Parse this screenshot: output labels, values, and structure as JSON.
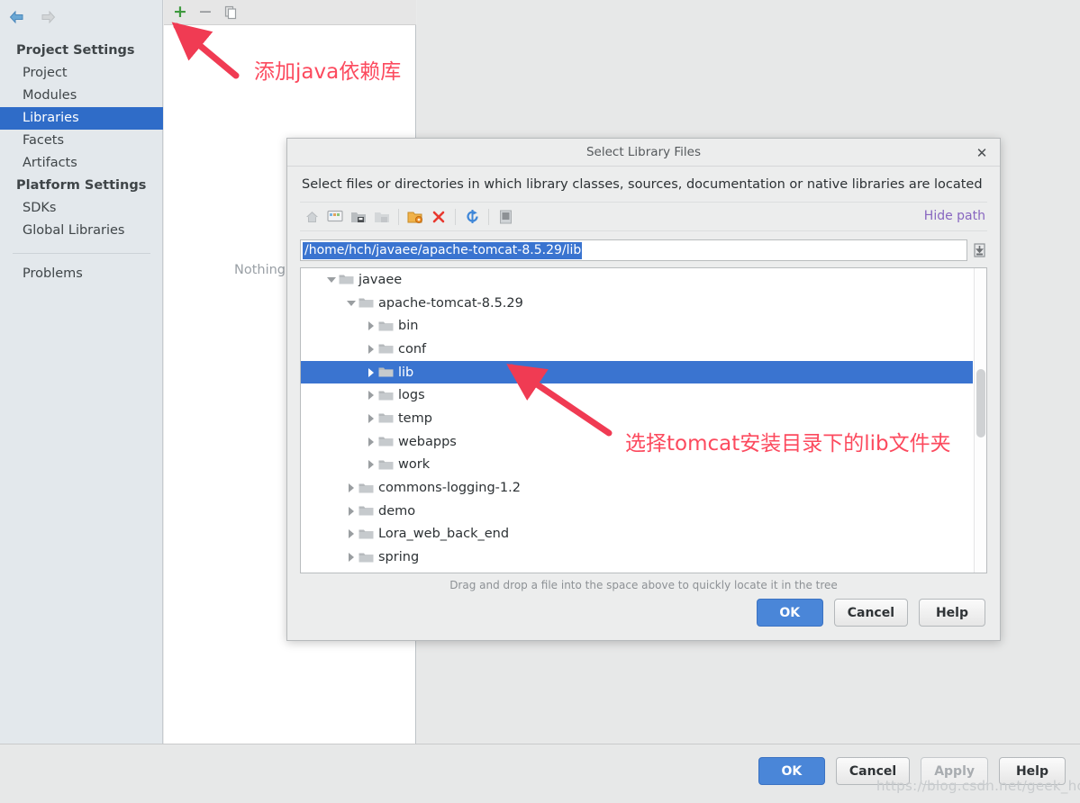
{
  "colors": {
    "accent_blue": "#3a74d0",
    "selection_blue": "#2f6cc8",
    "annotation_red": "#fc4a5e",
    "link_purple": "#8866c0",
    "plus_green": "#3f9a3f"
  },
  "main_window": {
    "nav": {
      "back_icon": "arrow-left-icon",
      "forward_icon": "arrow-right-icon"
    },
    "sidebar": {
      "groups": [
        {
          "title": "Project Settings",
          "items": [
            {
              "label": "Project",
              "selected": false
            },
            {
              "label": "Modules",
              "selected": false
            },
            {
              "label": "Libraries",
              "selected": true
            },
            {
              "label": "Facets",
              "selected": false
            },
            {
              "label": "Artifacts",
              "selected": false
            }
          ]
        },
        {
          "title": "Platform Settings",
          "items": [
            {
              "label": "SDKs",
              "selected": false
            },
            {
              "label": "Global Libraries",
              "selected": false
            }
          ]
        }
      ],
      "extra_items": [
        {
          "label": "Problems",
          "selected": false
        }
      ]
    },
    "center_panel": {
      "toolbar": [
        {
          "name": "add-button",
          "glyph": "+"
        },
        {
          "name": "remove-button",
          "glyph": "−"
        },
        {
          "name": "copy-button",
          "glyph": "copy-icon"
        }
      ],
      "empty_text": "Nothing"
    },
    "footer_buttons": [
      {
        "label": "OK",
        "style": "primary",
        "enabled": true
      },
      {
        "label": "Cancel",
        "style": "default",
        "enabled": true
      },
      {
        "label": "Apply",
        "style": "default",
        "enabled": false
      },
      {
        "label": "Help",
        "style": "default",
        "enabled": true
      }
    ],
    "watermark": "https://blog.csdn.net/geek_hch"
  },
  "dialog": {
    "title": "Select Library Files",
    "close_icon": "close-icon",
    "description": "Select files or directories in which library classes, sources, documentation or native libraries are located",
    "toolbar_icons": [
      "home-icon",
      "desktop-icon",
      "folder-save-icon",
      "folder-copy-icon",
      "new-folder-icon",
      "delete-icon",
      "refresh-icon",
      "show-hidden-icon"
    ],
    "hide_path_link": "Hide path",
    "path_value": "/home/hch/javaee/apache-tomcat-8.5.29/lib",
    "paste_icon": "paste-icon",
    "tree": [
      {
        "label": "javaee",
        "depth": 1,
        "expanded": true,
        "selected": false
      },
      {
        "label": "apache-tomcat-8.5.29",
        "depth": 2,
        "expanded": true,
        "selected": false
      },
      {
        "label": "bin",
        "depth": 3,
        "expanded": false,
        "selected": false
      },
      {
        "label": "conf",
        "depth": 3,
        "expanded": false,
        "selected": false
      },
      {
        "label": "lib",
        "depth": 3,
        "expanded": false,
        "selected": true
      },
      {
        "label": "logs",
        "depth": 3,
        "expanded": false,
        "selected": false
      },
      {
        "label": "temp",
        "depth": 3,
        "expanded": false,
        "selected": false
      },
      {
        "label": "webapps",
        "depth": 3,
        "expanded": false,
        "selected": false
      },
      {
        "label": "work",
        "depth": 3,
        "expanded": false,
        "selected": false
      },
      {
        "label": "commons-logging-1.2",
        "depth": 2,
        "expanded": false,
        "selected": false
      },
      {
        "label": "demo",
        "depth": 2,
        "expanded": false,
        "selected": false
      },
      {
        "label": "Lora_web_back_end",
        "depth": 2,
        "expanded": false,
        "selected": false
      },
      {
        "label": "spring",
        "depth": 2,
        "expanded": false,
        "selected": false
      }
    ],
    "drag_hint": "Drag and drop a file into the space above to quickly locate it in the tree",
    "buttons": [
      {
        "label": "OK",
        "style": "primary",
        "enabled": true
      },
      {
        "label": "Cancel",
        "style": "default",
        "enabled": true
      },
      {
        "label": "Help",
        "style": "default",
        "enabled": true
      }
    ]
  },
  "annotations": [
    {
      "text": "添加java依赖库"
    },
    {
      "text": "选择tomcat安装目录下的lib文件夹"
    }
  ]
}
